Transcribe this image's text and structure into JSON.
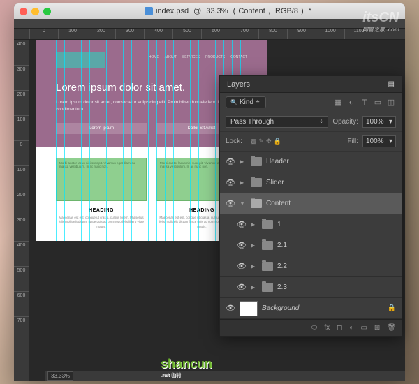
{
  "title": {
    "filename": "index.psd",
    "zoom": "33.3%",
    "layer": "Content",
    "mode": "RGB/8",
    "modified": "*"
  },
  "watermark1": {
    "text": "itsCN",
    "sub": "网管之家 .com"
  },
  "watermark2": {
    "text": "shancun",
    "sub": ".net 山村"
  },
  "ruler_h": [
    "0",
    "100",
    "200",
    "300",
    "400",
    "500",
    "600",
    "700",
    "800",
    "900",
    "1000",
    "1100"
  ],
  "ruler_v": [
    "400",
    "300",
    "200",
    "100",
    "0",
    "100",
    "200",
    "300",
    "400",
    "500",
    "600",
    "700"
  ],
  "hero": {
    "nav": [
      "HOME",
      "ABOUT",
      "SERVICES",
      "PRODUCTS",
      "CONTACT"
    ],
    "heading": "Lorem ipsum dolor sit amet.",
    "body": "Lorem ipsum dolor sit amet, consectetur adipiscing elit. Proin bibendum eleifend ipsum condimentum.",
    "btn1": "Lorem Ipsum",
    "btn2": "Dollor Sit Amet"
  },
  "cards": {
    "img_text": "Morbi auctor lacus nisi suscipit. Vivamus eget diam eu massa vestibulum. In ac nunc non.",
    "heading": "HEADING",
    "body": "Maecenas est est, congue ut cras a, cursus lorem. Phasellus felis mollit elit dictum fusce quis ac commodo felis libero vitae mattis."
  },
  "layers": {
    "title": "Layers",
    "filter": "Kind",
    "blend": "Pass Through",
    "opacity_lbl": "Opacity:",
    "opacity": "100%",
    "lock_lbl": "Lock:",
    "fill_lbl": "Fill:",
    "fill": "100%",
    "items": [
      {
        "name": "Header",
        "open": false
      },
      {
        "name": "Slider",
        "open": false
      },
      {
        "name": "Content",
        "open": true,
        "sel": true
      },
      {
        "name": "1",
        "child": true
      },
      {
        "name": "2.1",
        "child": true
      },
      {
        "name": "2.2",
        "child": true
      },
      {
        "name": "2.3",
        "child": true
      }
    ],
    "bg": "Background"
  },
  "scrollbar": {
    "zoom": "33.33%"
  }
}
